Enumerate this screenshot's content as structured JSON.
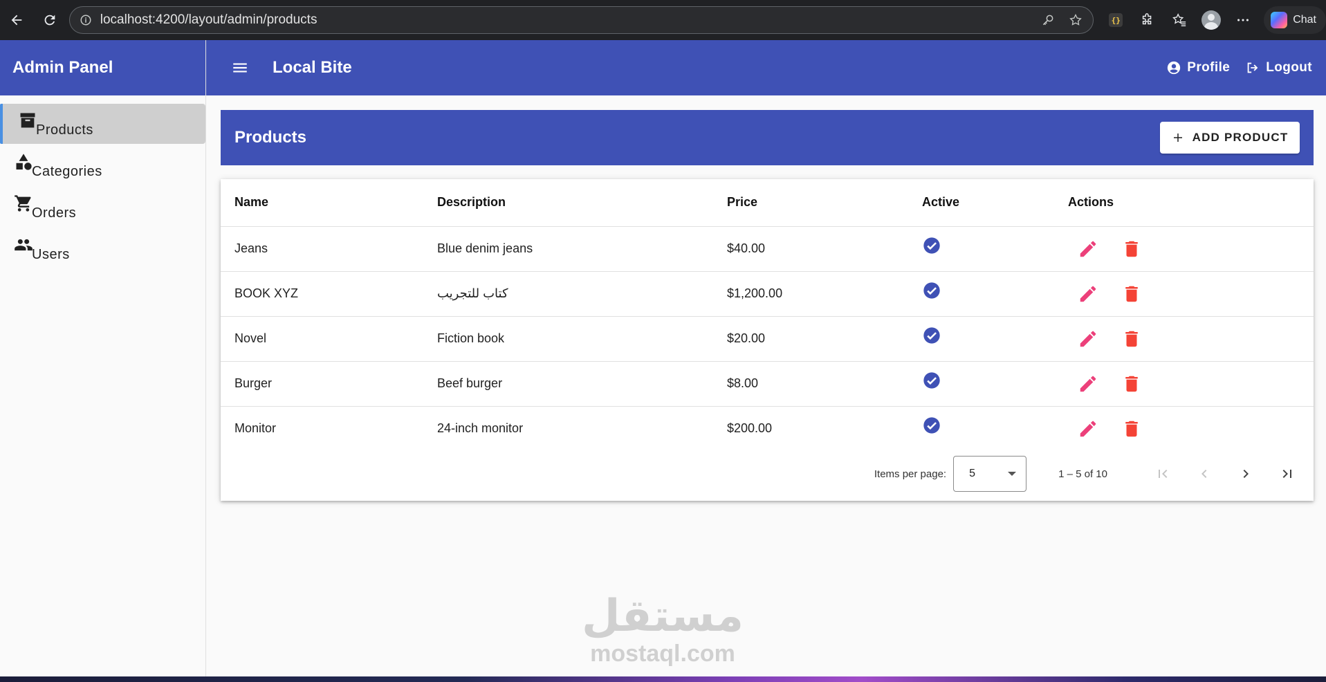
{
  "browser": {
    "url": "localhost:4200/layout/admin/products",
    "chat_label": "Chat"
  },
  "sidebar": {
    "title": "Admin Panel",
    "items": [
      {
        "label": "Products",
        "icon": "archive-icon",
        "active": true
      },
      {
        "label": "Categories",
        "icon": "category-icon",
        "active": false
      },
      {
        "label": "Orders",
        "icon": "cart-icon",
        "active": false
      },
      {
        "label": "Users",
        "icon": "people-icon",
        "active": false
      }
    ]
  },
  "topbar": {
    "title": "Local Bite",
    "profile_label": "Profile",
    "logout_label": "Logout"
  },
  "page": {
    "title": "Products",
    "add_button_label": "ADD PRODUCT"
  },
  "table": {
    "columns": [
      "Name",
      "Description",
      "Price",
      "Active",
      "Actions"
    ],
    "rows": [
      {
        "name": "Jeans",
        "description": "Blue denim jeans",
        "price": "$40.00",
        "active": true
      },
      {
        "name": "BOOK XYZ",
        "description": "كتاب للتجريب",
        "price": "$1,200.00",
        "active": true
      },
      {
        "name": "Novel",
        "description": "Fiction book",
        "price": "$20.00",
        "active": true
      },
      {
        "name": "Burger",
        "description": "Beef burger",
        "price": "$8.00",
        "active": true
      },
      {
        "name": "Monitor",
        "description": "24-inch monitor",
        "price": "$200.00",
        "active": true
      }
    ]
  },
  "paginator": {
    "items_per_page_label": "Items per page:",
    "items_per_page": "5",
    "range_label": "1 – 5 of 10"
  },
  "watermark": {
    "arabic": "مستقل",
    "latin": "mostaql.com"
  },
  "colors": {
    "primary": "#3f51b5",
    "edit": "#ec407a",
    "delete": "#f44336",
    "check": "#3f51b5"
  }
}
